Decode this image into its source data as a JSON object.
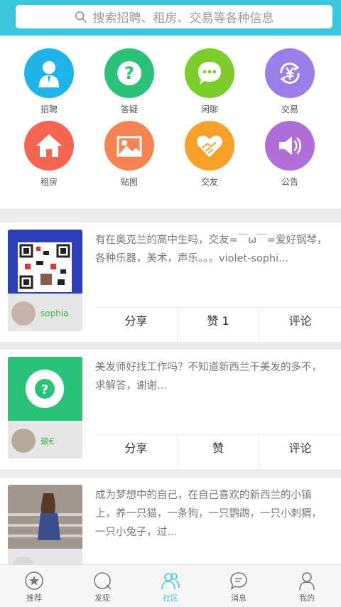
{
  "search": {
    "placeholder": "搜索招聘、租房、交易等各种信息",
    "icon": "search-icon"
  },
  "categories": [
    {
      "label": "招聘",
      "icon": "person-icon",
      "color": "#1fb3e8"
    },
    {
      "label": "答疑",
      "icon": "question-icon",
      "color": "#2bc178"
    },
    {
      "label": "闲聊",
      "icon": "chat-bubble-icon",
      "color": "#7ccd2c"
    },
    {
      "label": "交易",
      "icon": "yen-cycle-icon",
      "color": "#9a7ee8"
    },
    {
      "label": "租房",
      "icon": "house-icon",
      "color": "#f46552"
    },
    {
      "label": "贴图",
      "icon": "picture-icon",
      "color": "#f68352"
    },
    {
      "label": "交友",
      "icon": "heart-handshake-icon",
      "color": "#f7a02a"
    },
    {
      "label": "公告",
      "icon": "speaker-icon",
      "color": "#b06ed8"
    }
  ],
  "posts": [
    {
      "username": "sophia",
      "text": "有在奥克兰的高中生吗，交友=￣ω￣=爱好钢琴，各种乐器，美术，声乐。。。violet-sophi...",
      "share": "分享",
      "like": "赞 1",
      "comment": "评论",
      "thumb_color": "#2a3fb8"
    },
    {
      "username": "瑜€",
      "text": "美发师好找工作吗？不知道新西兰干美发的多不，求解答，谢谢...",
      "share": "分享",
      "like": "赞",
      "comment": "评论",
      "thumb_color": "#2bc178"
    },
    {
      "username": "",
      "text": "成为梦想中的自己，在自己喜欢的新西兰的小镇上，养一只猫，一条狗，一只鹦鹉，一只小刺猬，一只小兔子，过...",
      "share": "",
      "like": "",
      "comment": "",
      "thumb_color": "#9a8a84"
    }
  ],
  "tabbar": [
    {
      "label": "推荐",
      "icon": "star-icon",
      "active": false
    },
    {
      "label": "发现",
      "icon": "compass-icon",
      "active": false
    },
    {
      "label": "社区",
      "icon": "people-icon",
      "active": true
    },
    {
      "label": "消息",
      "icon": "message-icon",
      "active": false
    },
    {
      "label": "我的",
      "icon": "profile-icon",
      "active": false
    }
  ],
  "colors": {
    "accent": "#3cc6dc",
    "username_green": "#3db33a"
  }
}
